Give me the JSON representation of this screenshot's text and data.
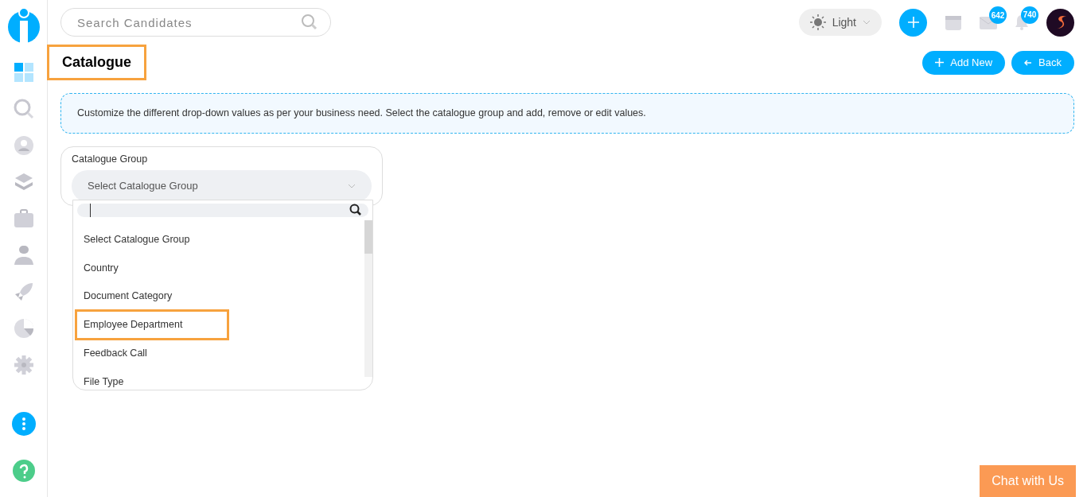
{
  "sidebar": {
    "items": [
      {
        "kind": "grid",
        "selected": true
      },
      {
        "kind": "search",
        "selected": false
      },
      {
        "kind": "user",
        "selected": false
      },
      {
        "kind": "layers",
        "selected": false
      },
      {
        "kind": "briefcase",
        "selected": false
      },
      {
        "kind": "person",
        "selected": false
      },
      {
        "kind": "rocket",
        "selected": false
      },
      {
        "kind": "pie",
        "selected": false
      },
      {
        "kind": "gear",
        "selected": false
      }
    ]
  },
  "topbar": {
    "search": {
      "placeholder": "Search Candidates"
    },
    "theme": "Light",
    "mail_count": "642",
    "bell_count": "740"
  },
  "page": {
    "title": "Catalogue",
    "title_highlighted": true,
    "buttons": [
      {
        "kind": "add",
        "label": "Add New"
      },
      {
        "kind": "back",
        "label": "Back"
      }
    ]
  },
  "info": "Customize the different drop-down values as per your business need. Select the catalogue group and add, remove or edit values.",
  "catalogue_group": {
    "label": "Catalogue Group",
    "value": "Select Catalogue Group",
    "options": [
      {
        "label": "Select Catalogue Group",
        "highlighted": false
      },
      {
        "label": "Country",
        "highlighted": false
      },
      {
        "label": "Document Category",
        "highlighted": false
      },
      {
        "label": "Employee Department",
        "highlighted": true
      },
      {
        "label": "Feedback Call",
        "highlighted": false
      },
      {
        "label": "File Type",
        "highlighted": false
      }
    ]
  },
  "chat": "Chat with Us"
}
